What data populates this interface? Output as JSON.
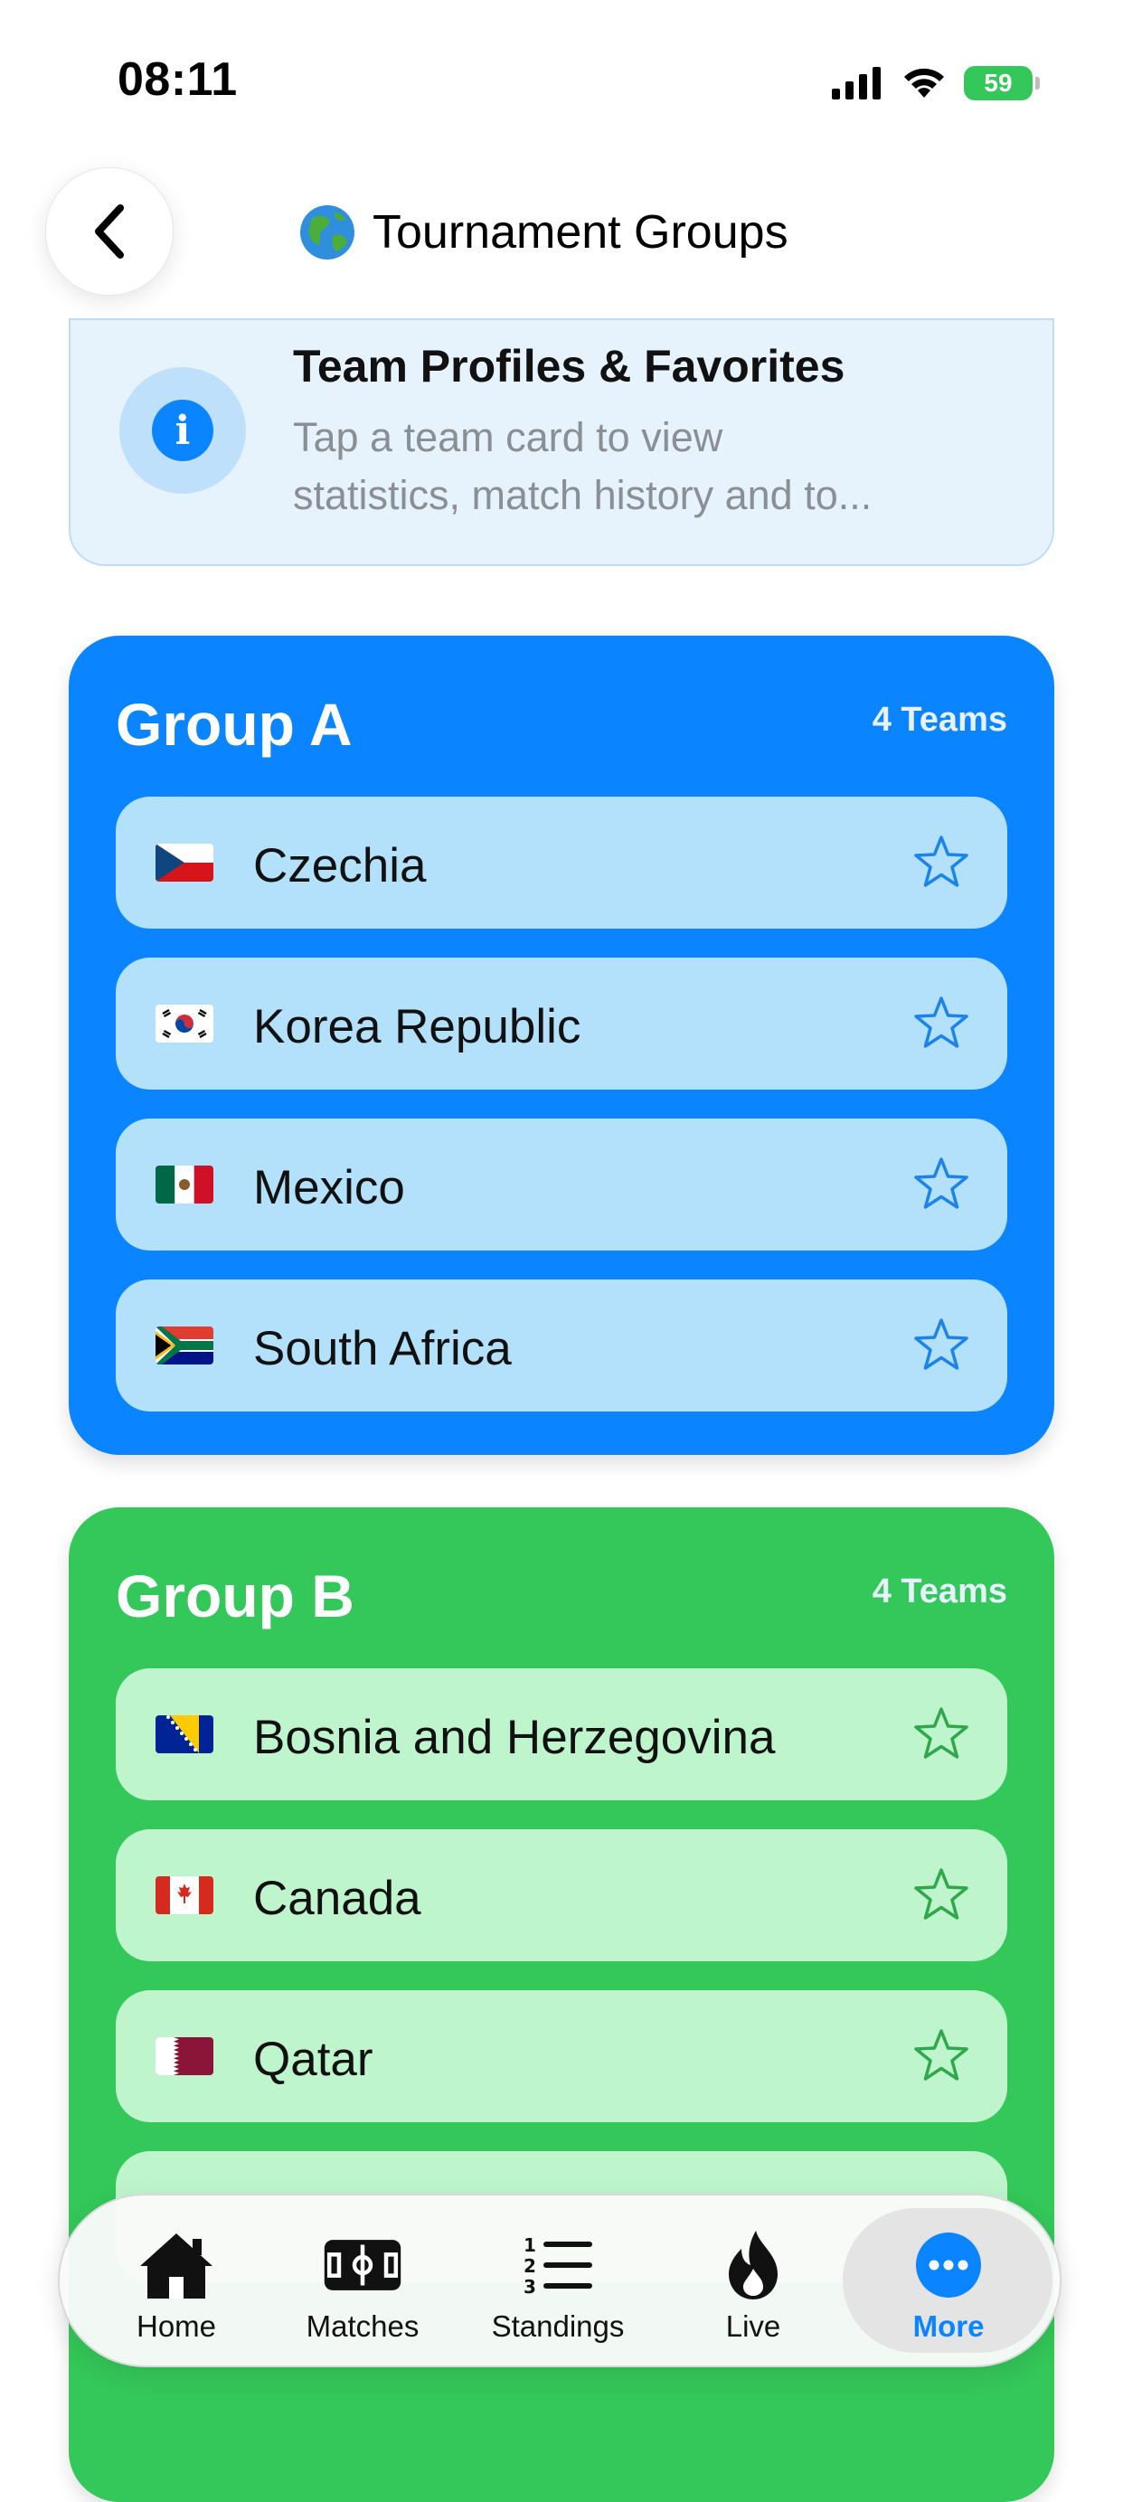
{
  "status_bar": {
    "time": "08:11",
    "battery": "59"
  },
  "header": {
    "title": "Tournament Groups",
    "title_icon": "globe-icon",
    "back_icon": "chevron-left-icon"
  },
  "info_card": {
    "title": "Team Profiles & Favorites",
    "body_line1": "Tap a team card to view",
    "body_line2": "statistics, match history and to..."
  },
  "groups": [
    {
      "name": "Group A",
      "count_label": "4 Teams",
      "color": "#0a84ff",
      "teams": [
        {
          "name": "Czechia",
          "flag": "czech-flag-icon"
        },
        {
          "name": "Korea Republic",
          "flag": "south-korea-flag-icon"
        },
        {
          "name": "Mexico",
          "flag": "mexico-flag-icon"
        },
        {
          "name": "South Africa",
          "flag": "south-africa-flag-icon"
        }
      ]
    },
    {
      "name": "Group B",
      "count_label": "4 Teams",
      "color": "#34c759",
      "teams": [
        {
          "name": "Bosnia and Herzegovina",
          "flag": "bosnia-flag-icon"
        },
        {
          "name": "Canada",
          "flag": "canada-flag-icon"
        },
        {
          "name": "Qatar",
          "flag": "qatar-flag-icon"
        }
      ]
    }
  ],
  "tabbar": {
    "items": [
      {
        "label": "Home",
        "icon": "house-icon"
      },
      {
        "label": "Matches",
        "icon": "soccer-field-icon"
      },
      {
        "label": "Standings",
        "icon": "numbered-list-icon"
      },
      {
        "label": "Live",
        "icon": "flame-icon"
      },
      {
        "label": "More",
        "icon": "ellipsis-circle-icon",
        "active": true
      }
    ],
    "active_color": "#0a84ff"
  }
}
